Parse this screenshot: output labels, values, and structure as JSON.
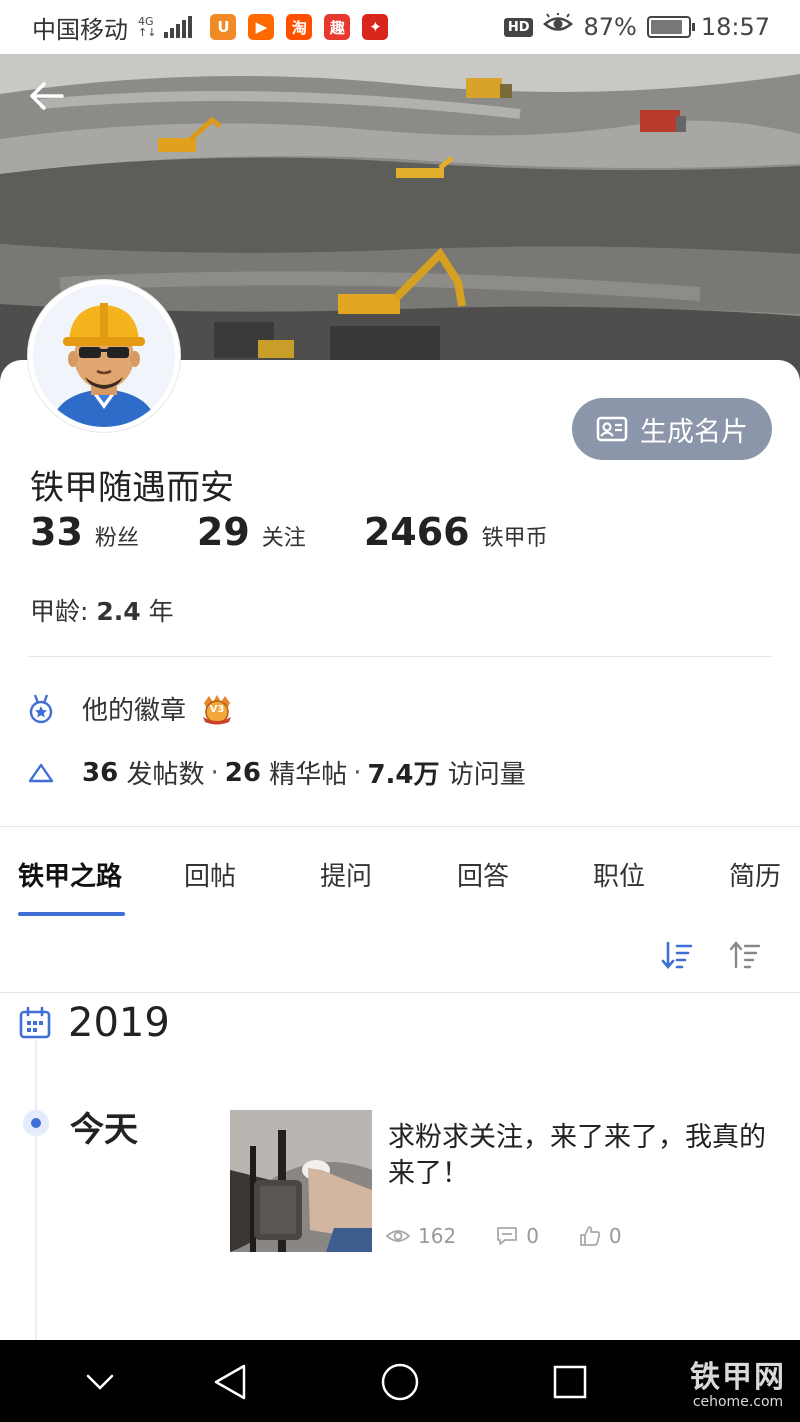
{
  "status_bar": {
    "carrier": "中国移动",
    "network_top": "4G",
    "network_bottom": "↑↓",
    "apps": [
      {
        "name": "uc-browser",
        "glyph": "U",
        "color": "#f08a24"
      },
      {
        "name": "video-app",
        "glyph": "▶",
        "color": "#ff6a00"
      },
      {
        "name": "taobao",
        "glyph": "淘",
        "color": "#ff5000"
      },
      {
        "name": "app-4",
        "glyph": "趣",
        "color": "#e8382f"
      },
      {
        "name": "app-5",
        "glyph": "✦",
        "color": "#d9261c"
      }
    ],
    "hd": "HD",
    "battery_percent": "87%",
    "battery_level": 0.87,
    "time": "18:57"
  },
  "profile": {
    "card_button_label": "生成名片",
    "name": "铁甲随遇而安",
    "stats": [
      {
        "value": "33",
        "label": "粉丝"
      },
      {
        "value": "29",
        "label": "关注"
      },
      {
        "value": "2466",
        "label": "铁甲币"
      }
    ],
    "age_label": "甲龄:",
    "age_value": "2.4",
    "age_unit": "年"
  },
  "badges": {
    "label": "他的徽章",
    "badge_text": "V3"
  },
  "post_stats": {
    "posts_value": "36",
    "posts_label": "发帖数",
    "featured_value": "26",
    "featured_label": "精华帖",
    "visits_value": "7.4万",
    "visits_label": "访问量",
    "separator": "·"
  },
  "tabs": [
    {
      "label": "铁甲之路",
      "active": true
    },
    {
      "label": "回帖",
      "active": false
    },
    {
      "label": "提问",
      "active": false
    },
    {
      "label": "回答",
      "active": false
    },
    {
      "label": "职位",
      "active": false
    },
    {
      "label": "简历",
      "active": false
    }
  ],
  "timeline": {
    "year": "2019",
    "day_label": "今天",
    "post": {
      "title": "求粉求关注，来了来了，我真的来了！",
      "views": "162",
      "comments": "0",
      "likes": "0"
    }
  },
  "watermark": {
    "brand": "铁甲网",
    "domain": "cehome.com"
  },
  "colors": {
    "accent": "#3f6fd6",
    "card_button": "#8c96aa"
  }
}
